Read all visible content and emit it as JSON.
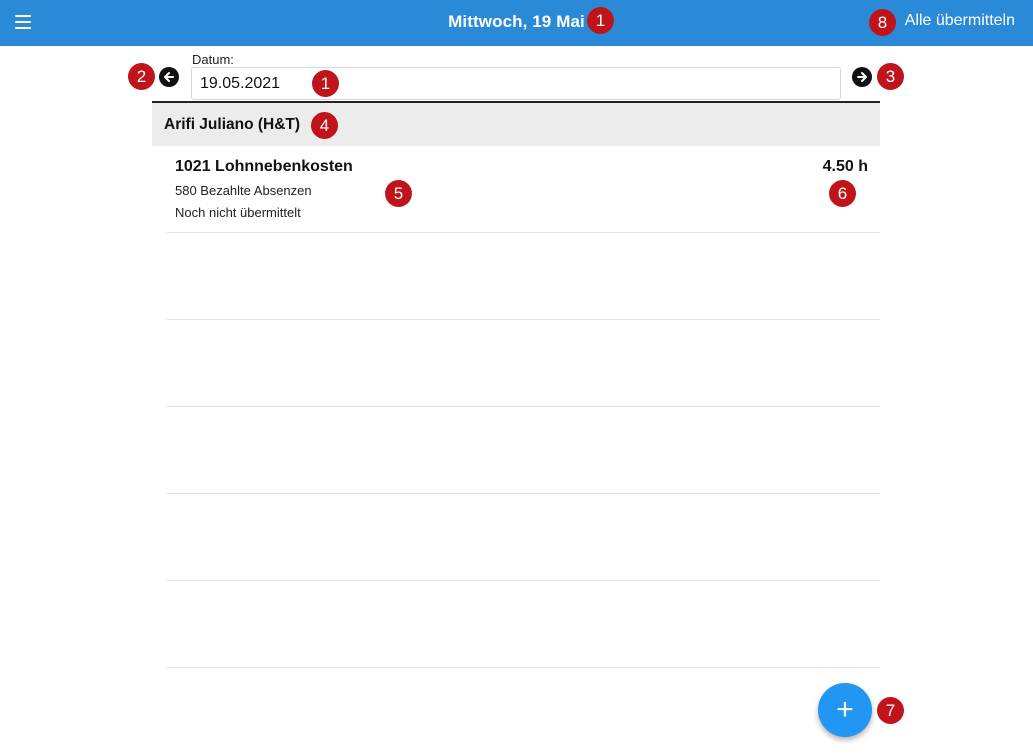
{
  "header": {
    "title": "Mittwoch, 19 Mai",
    "submit_all_label": "Alle übermitteln"
  },
  "date": {
    "label": "Datum:",
    "value": "19.05.2021"
  },
  "group": {
    "name": "Arifi Juliano (H&T)"
  },
  "entries": [
    {
      "title": "1021 Lohnnebenkosten",
      "subtitle": "580 Bezahlte Absenzen",
      "status": "Noch nicht übermittelt",
      "hours": "4.50 h"
    }
  ],
  "fab": {
    "icon": "plus-icon",
    "symbol": "+"
  },
  "badges": {
    "title": "1",
    "prev": "2",
    "next": "3",
    "group": "4",
    "entry": "5",
    "hours": "6",
    "fab": "7",
    "submit": "8",
    "date_input": "1"
  },
  "colors": {
    "topbar": "#2b8ad8",
    "badge": "#c0141b",
    "fab": "#2196f3"
  }
}
